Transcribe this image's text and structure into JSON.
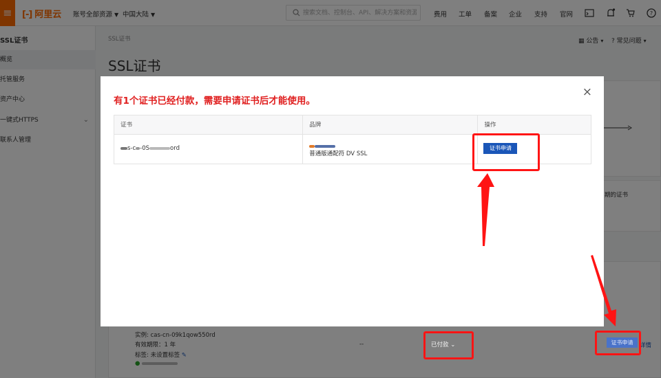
{
  "topbar": {
    "logo": "阿里云",
    "logo_bracket": "[-]",
    "account": "账号全部资源",
    "region": "中国大陆",
    "search_placeholder": "搜索文档、控制台、API、解决方案和资源",
    "links": [
      "费用",
      "工单",
      "备案",
      "企业",
      "支持",
      "官网"
    ]
  },
  "sidebar": {
    "title": "SSL证书",
    "items": [
      {
        "label": "概览"
      },
      {
        "label": "托管服务"
      },
      {
        "label": "资产中心"
      },
      {
        "label": "一键式HTTPS"
      },
      {
        "label": "联系人管理"
      }
    ]
  },
  "page": {
    "breadcrumb": "SSL证书",
    "title": "SSL证书",
    "notice": "公告",
    "faq": "常见问题",
    "expiring_label": "期的证书"
  },
  "background_row": {
    "instance": "实例: cas-cn-09k1qow550rd",
    "validity": "有效期限：1 年",
    "tags": "标签: 未设置标签",
    "dash": "--",
    "status": "已付款",
    "apply": "证书申请",
    "details": "详情"
  },
  "modal": {
    "title": "有1个证书已经付款，需要申请证书后才能使用。",
    "close": "×",
    "columns": [
      "证书",
      "品牌",
      "操作"
    ],
    "row": {
      "cert_text_a": "s-c",
      "cert_text_b": "-0S",
      "cert_text_c": "ord",
      "brand": "普通版通配符 DV SSL",
      "action": "证书申请"
    }
  },
  "colors": {
    "brand": "#ff6a00",
    "primary_button": "#1a56b8",
    "alert_text": "#e02020",
    "annotation": "#ff1414"
  }
}
